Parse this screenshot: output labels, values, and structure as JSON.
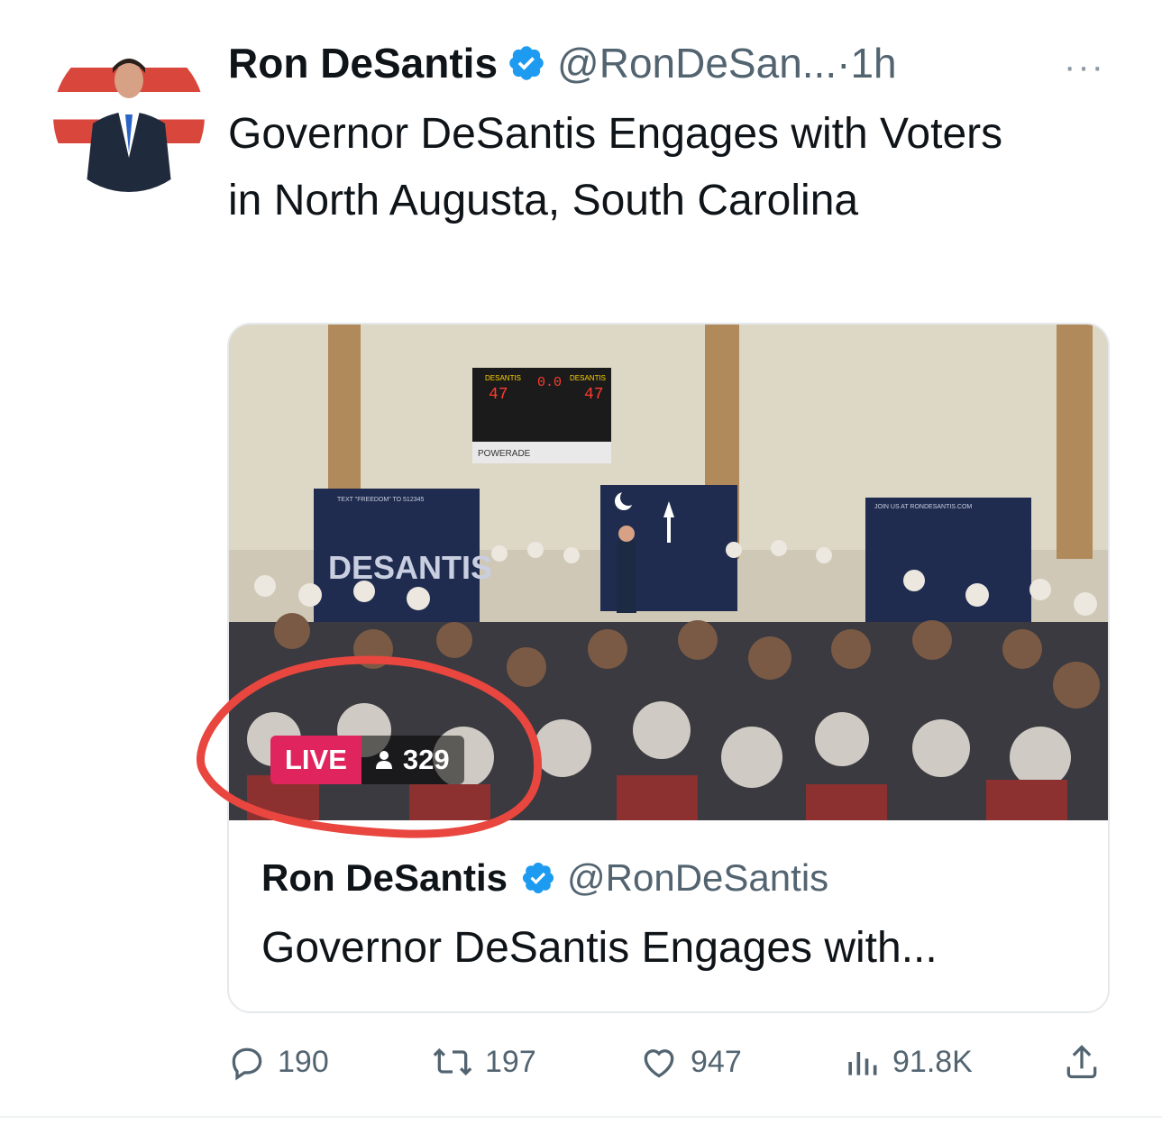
{
  "tweet": {
    "author_name": "Ron DeSantis",
    "handle": "@RonDeSan...",
    "time": "·1h",
    "more_label": "···",
    "text": "Governor DeSantis Engages with Voters in North Augusta, South Carolina"
  },
  "media": {
    "live_label": "LIVE",
    "viewer_count": "329",
    "scoreboard": {
      "home_label": "DESANTIS",
      "away_label": "DESANTIS",
      "home_score": "47",
      "away_score": "47",
      "clock": "0.0",
      "sponsor": "POWERADE"
    },
    "left_banner": "DESANTIS",
    "left_banner_top": "TEXT \"FREEDOM\" TO 512345",
    "right_banner_top": "JOIN US AT RONDESANTIS.COM"
  },
  "quoted": {
    "author_name": "Ron DeSantis",
    "handle": "@RonDeSantis",
    "text": "Governor DeSantis Engages with..."
  },
  "actions": {
    "replies": "190",
    "retweets": "197",
    "likes": "947",
    "views": "91.8K"
  },
  "colors": {
    "verified": "#1d9bf0",
    "live": "#e0245e",
    "annotation": "#e8463e"
  }
}
